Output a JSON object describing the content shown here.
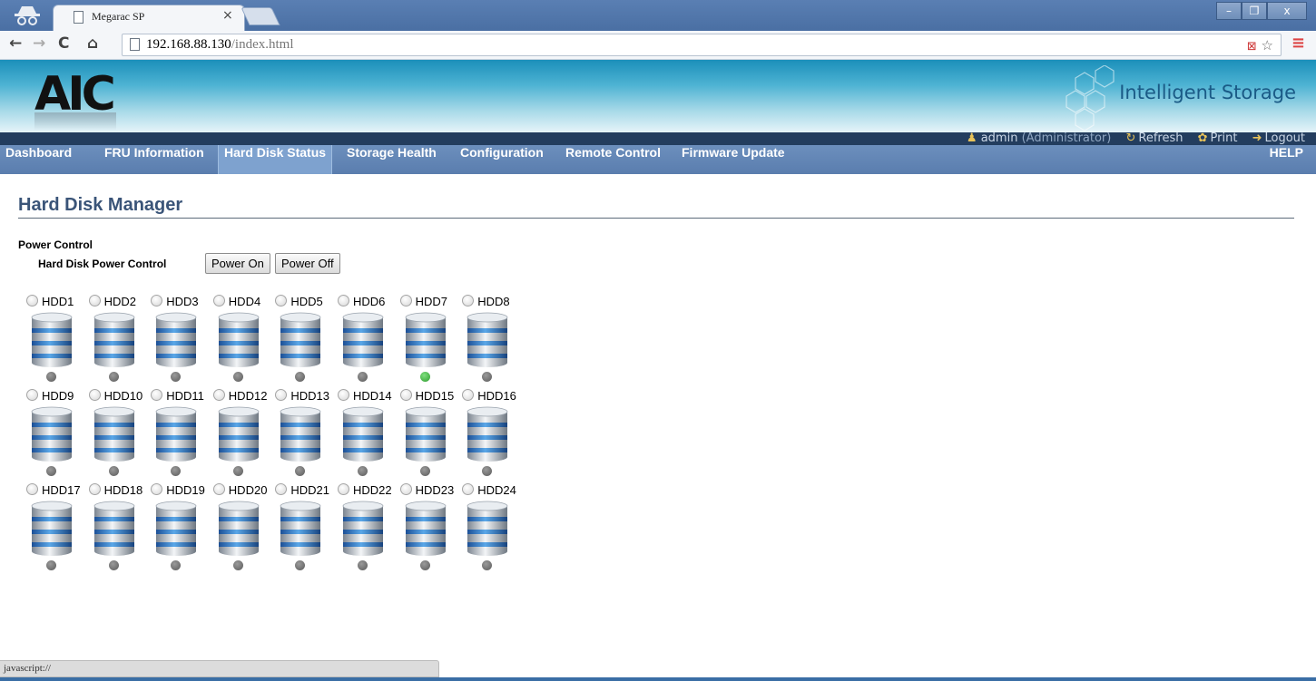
{
  "browser": {
    "tab_title": "Megarac SP",
    "tab_close": "×",
    "url_host": "192.168.88.130",
    "url_path": "/index.html",
    "nav": {
      "back": "←",
      "forward": "→",
      "reload": "C",
      "home": "⌂"
    },
    "toolbar_icons": "☆",
    "menu_icon": "≡",
    "window_controls": {
      "minimize": "–",
      "maximize": "❐",
      "close": "x"
    }
  },
  "header": {
    "logo": "AIC",
    "brand": "Intelligent Storage",
    "user": "admin",
    "role": "(Administrator)",
    "links": {
      "refresh": "Refresh",
      "print": "Print",
      "logout": "Logout"
    }
  },
  "menu": {
    "items": [
      {
        "label": "Dashboard",
        "active": false
      },
      {
        "label": "FRU Information",
        "active": false
      },
      {
        "label": "Hard Disk Status",
        "active": true
      },
      {
        "label": "Storage Health",
        "active": false
      },
      {
        "label": "Configuration",
        "active": false
      },
      {
        "label": "Remote Control",
        "active": false
      },
      {
        "label": "Firmware Update",
        "active": false
      }
    ],
    "help": "HELP"
  },
  "main": {
    "title": "Hard Disk Manager",
    "power_control": {
      "heading": "Power Control",
      "label": "Hard Disk Power Control",
      "power_on": "Power On",
      "power_off": "Power Off"
    },
    "disks": [
      {
        "label": "HDD1",
        "active": false
      },
      {
        "label": "HDD2",
        "active": false
      },
      {
        "label": "HDD3",
        "active": false
      },
      {
        "label": "HDD4",
        "active": false
      },
      {
        "label": "HDD5",
        "active": false
      },
      {
        "label": "HDD6",
        "active": false
      },
      {
        "label": "HDD7",
        "active": true
      },
      {
        "label": "HDD8",
        "active": false
      },
      {
        "label": "HDD9",
        "active": false
      },
      {
        "label": "HDD10",
        "active": false
      },
      {
        "label": "HDD11",
        "active": false
      },
      {
        "label": "HDD12",
        "active": false
      },
      {
        "label": "HDD13",
        "active": false
      },
      {
        "label": "HDD14",
        "active": false
      },
      {
        "label": "HDD15",
        "active": false
      },
      {
        "label": "HDD16",
        "active": false
      },
      {
        "label": "HDD17",
        "active": false
      },
      {
        "label": "HDD18",
        "active": false
      },
      {
        "label": "HDD19",
        "active": false
      },
      {
        "label": "HDD20",
        "active": false
      },
      {
        "label": "HDD21",
        "active": false
      },
      {
        "label": "HDD22",
        "active": false
      },
      {
        "label": "HDD23",
        "active": false
      },
      {
        "label": "HDD24",
        "active": false
      }
    ],
    "led_on_color": "#3aa83a",
    "led_off_color": "#6a6a6a"
  },
  "status_bar": {
    "text": "javascript://"
  }
}
